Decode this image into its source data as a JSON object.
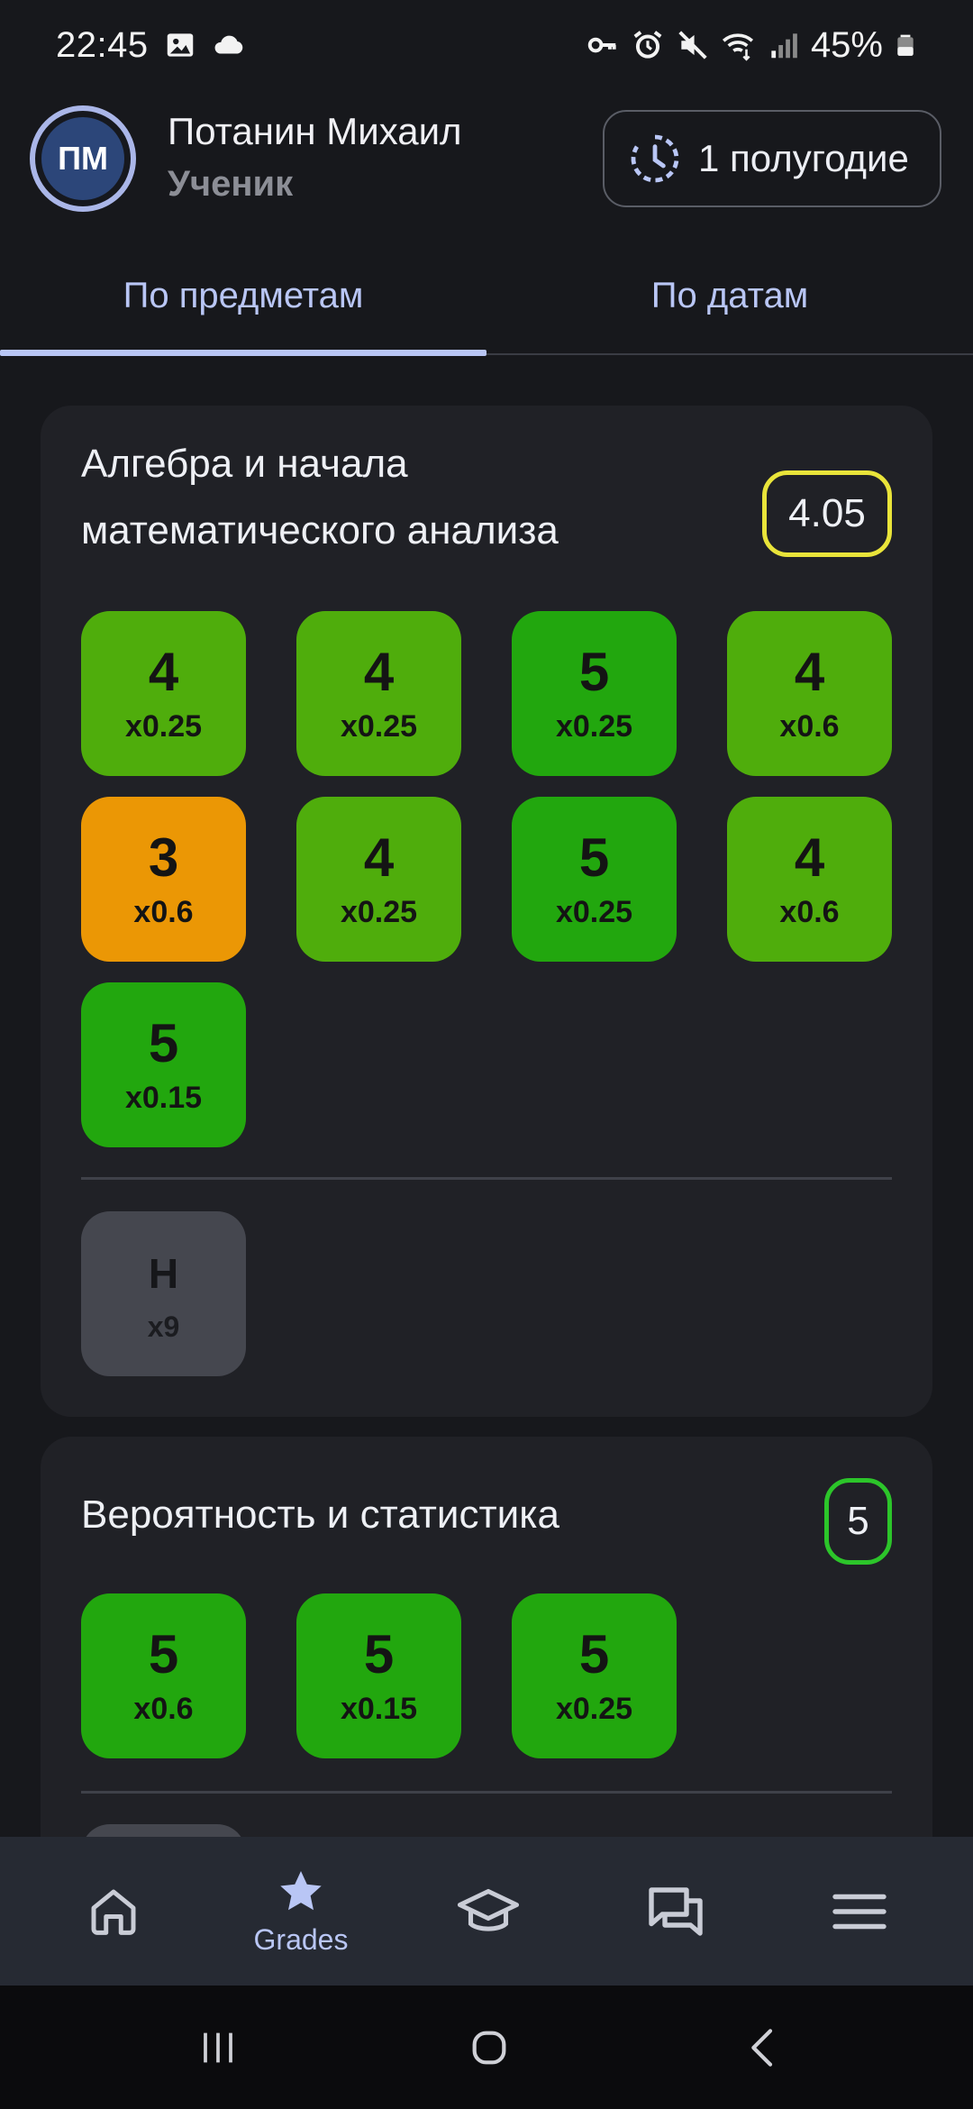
{
  "status_bar": {
    "time": "22:45",
    "battery_percent": "45%",
    "left_icons": [
      "image-icon",
      "cloud-icon"
    ],
    "right_icons": [
      "vpn-key-icon",
      "alarm-icon",
      "mute-icon",
      "wifi-icon",
      "signal-icon",
      "battery-icon"
    ]
  },
  "header": {
    "avatar_initials": "ПМ",
    "user_name": "Потанин Михаил",
    "user_role": "Ученик",
    "period_label": "1 полугодие"
  },
  "tabs": [
    {
      "label": "По предметам",
      "active": true
    },
    {
      "label": "По датам",
      "active": false
    }
  ],
  "subjects": [
    {
      "title": "Алгебра и начала математического анализа",
      "average": "4.05",
      "average_color": "#e9e43a",
      "grades": [
        {
          "value": "4",
          "weight": "x0.25"
        },
        {
          "value": "4",
          "weight": "x0.25"
        },
        {
          "value": "5",
          "weight": "x0.25"
        },
        {
          "value": "4",
          "weight": "x0.6"
        },
        {
          "value": "3",
          "weight": "x0.6"
        },
        {
          "value": "4",
          "weight": "x0.25"
        },
        {
          "value": "5",
          "weight": "x0.25"
        },
        {
          "value": "4",
          "weight": "x0.6"
        },
        {
          "value": "5",
          "weight": "x0.15"
        }
      ],
      "absences": [
        {
          "value": "Н",
          "weight": "x9"
        }
      ]
    },
    {
      "title": "Вероятность и статистика",
      "average": "5",
      "average_color": "#2cc52a",
      "grades": [
        {
          "value": "5",
          "weight": "x0.6"
        },
        {
          "value": "5",
          "weight": "x0.15"
        },
        {
          "value": "5",
          "weight": "x0.25"
        }
      ]
    }
  ],
  "grade_colors": {
    "5": "#22a70e",
    "4": "#4fad0c",
    "3": "#eb9705",
    "absence": "#45474f"
  },
  "bottom_nav": [
    {
      "icon": "home-icon",
      "label": ""
    },
    {
      "icon": "star-icon",
      "label": "Grades",
      "active": true
    },
    {
      "icon": "graduation-cap-icon",
      "label": ""
    },
    {
      "icon": "chat-icon",
      "label": ""
    },
    {
      "icon": "menu-icon",
      "label": ""
    }
  ],
  "system_nav": [
    "recents-icon",
    "home-circle-icon",
    "back-icon"
  ],
  "accent_color": "#b9c6f5"
}
